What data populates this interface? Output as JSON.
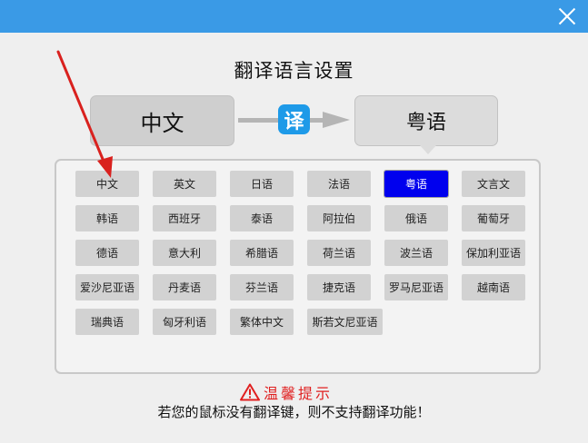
{
  "dialog": {
    "title": "翻译语言设置"
  },
  "source_language": "中文",
  "target_language": "粤语",
  "translate_badge": "译",
  "languages": [
    {
      "label": "中文",
      "selected": false
    },
    {
      "label": "英文",
      "selected": false
    },
    {
      "label": "日语",
      "selected": false
    },
    {
      "label": "法语",
      "selected": false
    },
    {
      "label": "粤语",
      "selected": true
    },
    {
      "label": "文言文",
      "selected": false
    },
    {
      "label": "韩语",
      "selected": false
    },
    {
      "label": "西班牙",
      "selected": false
    },
    {
      "label": "泰语",
      "selected": false
    },
    {
      "label": "阿拉伯",
      "selected": false
    },
    {
      "label": "俄语",
      "selected": false
    },
    {
      "label": "葡萄牙",
      "selected": false
    },
    {
      "label": "德语",
      "selected": false
    },
    {
      "label": "意大利",
      "selected": false
    },
    {
      "label": "希腊语",
      "selected": false
    },
    {
      "label": "荷兰语",
      "selected": false
    },
    {
      "label": "波兰语",
      "selected": false
    },
    {
      "label": "保加利亚语",
      "selected": false
    },
    {
      "label": "爱沙尼亚语",
      "selected": false
    },
    {
      "label": "丹麦语",
      "selected": false
    },
    {
      "label": "芬兰语",
      "selected": false
    },
    {
      "label": "捷克语",
      "selected": false
    },
    {
      "label": "罗马尼亚语",
      "selected": false
    },
    {
      "label": "越南语",
      "selected": false
    },
    {
      "label": "瑞典语",
      "selected": false
    },
    {
      "label": "匈牙利语",
      "selected": false
    },
    {
      "label": "繁体中文",
      "selected": false
    },
    {
      "label": "斯若文尼亚语",
      "selected": false
    }
  ],
  "tip": {
    "title": "温馨提示",
    "text": "若您的鼠标没有翻译键，则不支持翻译功能！"
  },
  "colors": {
    "titlebar": "#3a9ae6",
    "selected": "#0000ee",
    "annotation_arrow": "#d9211e",
    "tip_title": "#e02020"
  },
  "icons": {
    "close": "close-icon",
    "warning": "warning-triangle-icon",
    "arrow": "right-arrow-icon"
  }
}
